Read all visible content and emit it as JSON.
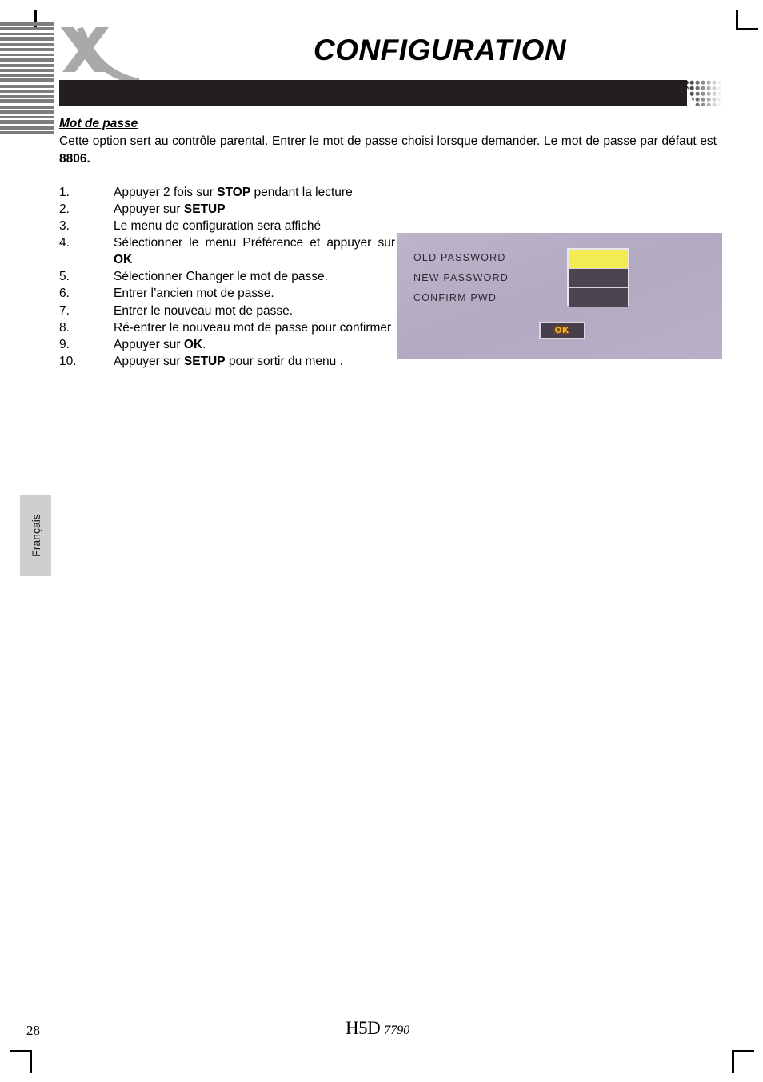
{
  "document": {
    "title": "CONFIGURATION",
    "brand_logo": "x-swoosh-logo",
    "language_tab": "Français",
    "page_number": "28",
    "footer_logo_brand": "H5D",
    "footer_logo_model": "7790"
  },
  "section": {
    "heading": "Mot de passe",
    "intro_before": "Cette option sert au contrôle parental. Entrer le mot de passe choisi lorsque demander. Le mot de passe par défaut est ",
    "intro_bold": "8806.",
    "steps": [
      {
        "num": "1.",
        "before": "Appuyer 2 fois sur ",
        "bold": "STOP",
        "after": " pendant la lecture",
        "justify": false
      },
      {
        "num": "2.",
        "before": "Appuyer sur ",
        "bold": "SETUP",
        "after": "",
        "justify": false
      },
      {
        "num": "3.",
        "before": "Le menu de configuration sera affiché",
        "bold": "",
        "after": "",
        "justify": false
      },
      {
        "num": "4.",
        "before": "Sélectionner le menu Préférence et appuyer sur ",
        "bold": "OK",
        "after": "",
        "justify": true
      },
      {
        "num": "5.",
        "before": "Sélectionner Changer le mot de passe.",
        "bold": "",
        "after": "",
        "justify": false
      },
      {
        "num": "6.",
        "before": "Entrer l’ancien mot de passe.",
        "bold": "",
        "after": "",
        "justify": false
      },
      {
        "num": "7.",
        "before": "Entrer le nouveau mot de passe.",
        "bold": "",
        "after": "",
        "justify": false
      },
      {
        "num": "8.",
        "before": "Ré-entrer le nouveau mot de passe pour confirmer",
        "bold": "",
        "after": "",
        "justify": true
      },
      {
        "num": "9.",
        "before": "Appuyer sur ",
        "bold": "OK",
        "after": ".",
        "justify": false
      },
      {
        "num": "10.",
        "before": "Appuyer sur ",
        "bold": "SETUP",
        "after": " pour sortir du menu .",
        "justify": false
      }
    ]
  },
  "osd_screenshot": {
    "labels": {
      "old_password": "OLD  PASSWORD",
      "new_password": "NEW  PASSWORD",
      "confirm_pwd": "CONFIRM  PWD"
    },
    "ok_button": "OK",
    "fields": [
      {
        "name": "old-password-field",
        "state": "active"
      },
      {
        "name": "new-password-field",
        "state": "idle"
      },
      {
        "name": "confirm-password-field",
        "state": "idle"
      }
    ],
    "colors": {
      "background": "#b7aec6",
      "field_active": "#f2ec52",
      "field_idle": "#4b4550",
      "ok_text": "#f5c518"
    }
  },
  "decor": {
    "header_bar_color": "#231f20",
    "stripe_color": "#7d7d7d",
    "logo_color": "#a9a9a9",
    "lang_tab_bg": "#cfcfcf"
  }
}
